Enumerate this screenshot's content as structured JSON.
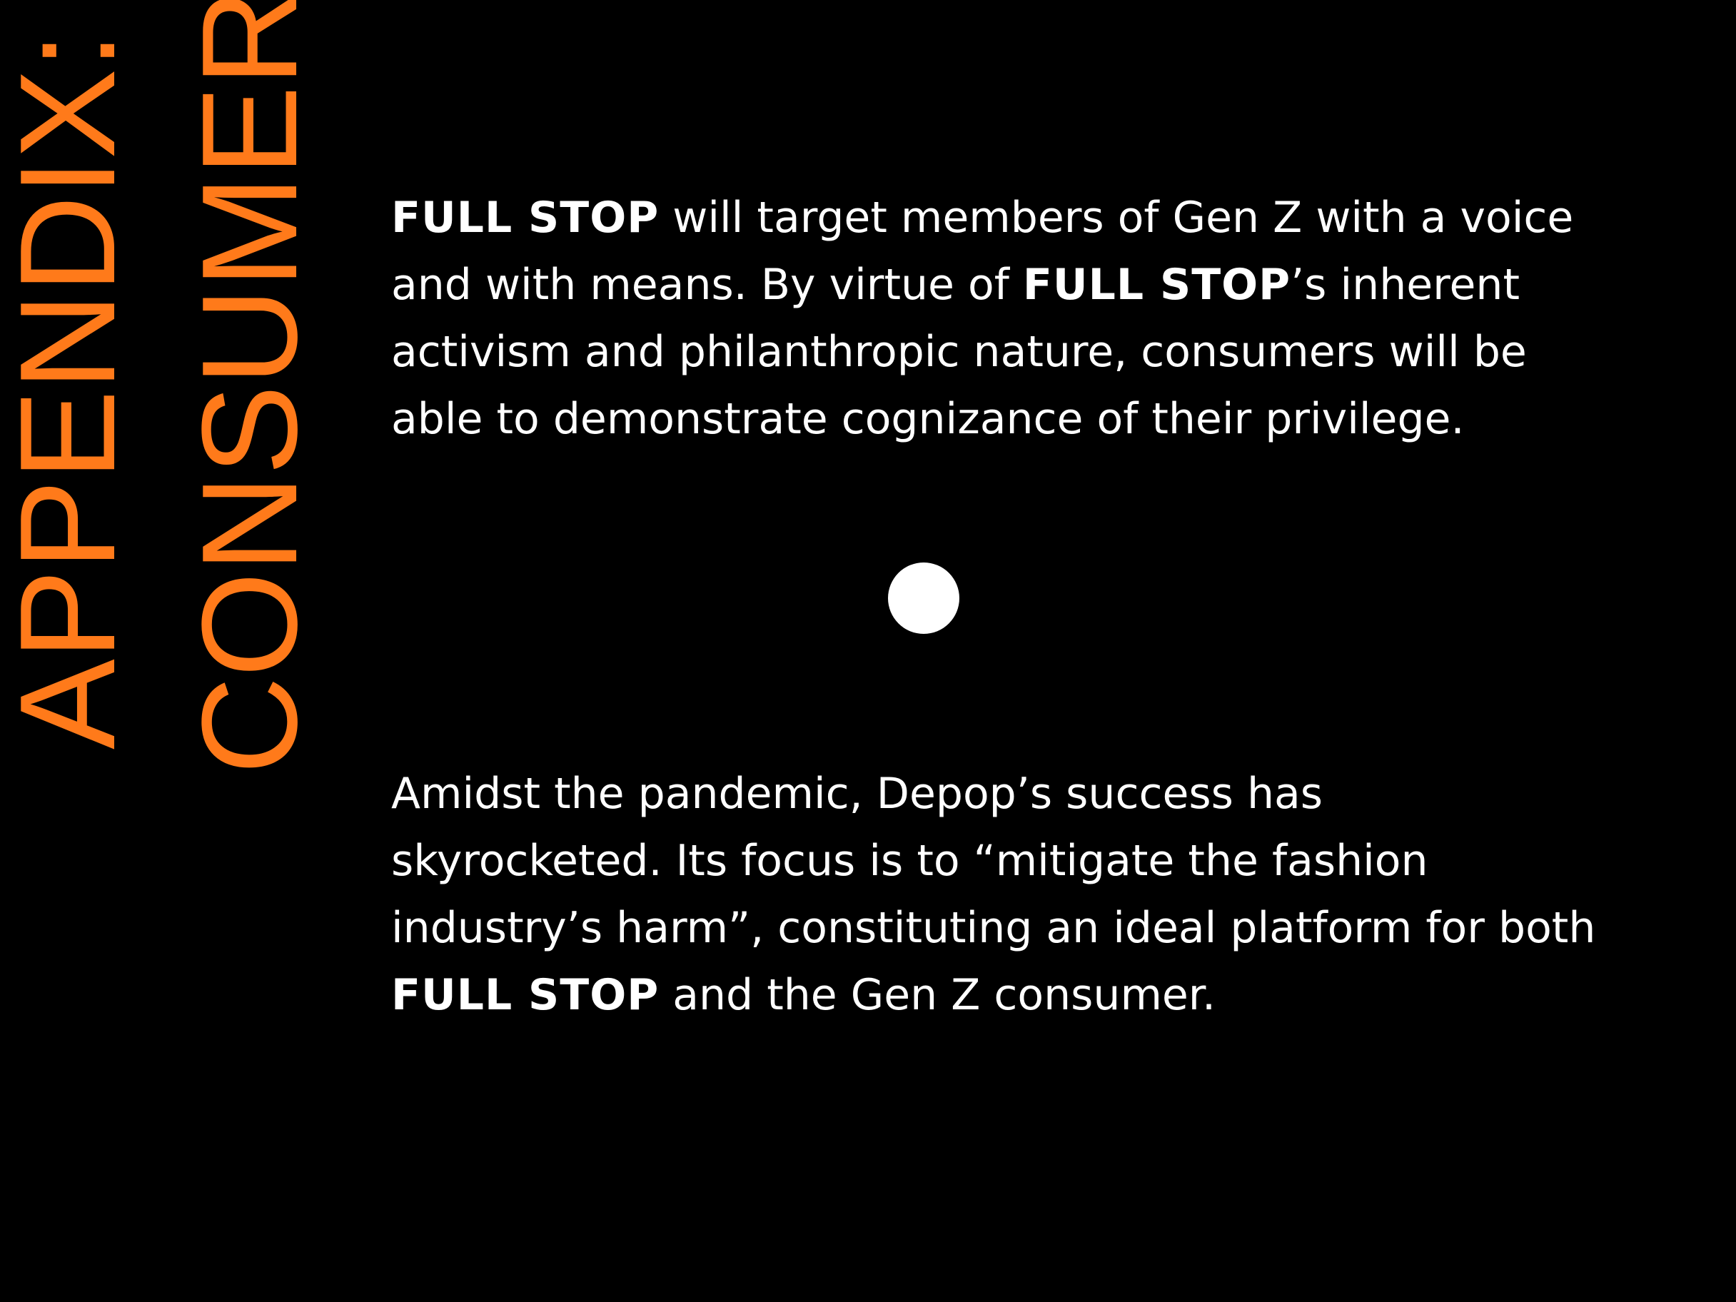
{
  "title": {
    "line1": "APPENDIX:",
    "line2": "CONSUMER"
  },
  "paragraph1": {
    "brand_1": "FULL STOP",
    "text_1": " will target members of Gen Z with a voice and with means. By virtue of ",
    "brand_2": "FULL STOP",
    "text_2": "’s inherent activism and philanthropic nature, consumers will be able to demonstrate cognizance of their privilege."
  },
  "paragraph2": {
    "text_1": "Amidst the pandemic, Depop’s success has skyrocketed. Its focus is to “mitigate the fashion industry’s harm”, constituting an ideal platform for both ",
    "brand_1": "FULL STOP",
    "text_2": " and the Gen Z consumer."
  },
  "colors": {
    "background": "#000000",
    "accent": "#FF7A1A",
    "text": "#FFFFFF"
  }
}
